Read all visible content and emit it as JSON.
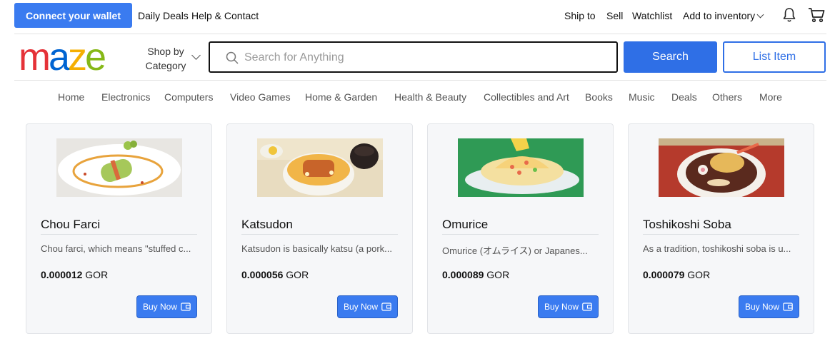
{
  "topbar": {
    "wallet_button": "Connect your wallet",
    "links": [
      "Daily Deals",
      "Help & Contact"
    ],
    "right_links": [
      "Ship to",
      "Sell",
      "Watchlist"
    ],
    "inventory_dropdown": "Add to inventory",
    "icons": [
      "bell-icon",
      "cart-icon"
    ]
  },
  "header": {
    "logo": {
      "text": "maze",
      "colors": [
        "#e53238",
        "#0064d2",
        "#f5af02",
        "#86b817"
      ]
    },
    "shop_by_line1": "Shop by",
    "shop_by_line2": "Category",
    "search_placeholder": "Search for Anything",
    "search_button": "Search",
    "list_button": "List Item"
  },
  "nav": {
    "items": [
      "Home",
      "Electronics",
      "Computers",
      "Video Games",
      "Home & Garden",
      "Health & Beauty",
      "Collectibles and Art",
      "Books",
      "Music",
      "Deals",
      "Others",
      "More"
    ]
  },
  "products": [
    {
      "title": "Chou Farci",
      "description": "Chou farci, which means \"stuffed c...",
      "price": "0.000012",
      "currency": "GOR",
      "button": "Buy Now",
      "image_icon": "chou-farci-image"
    },
    {
      "title": "Katsudon",
      "description": "Katsudon is basically katsu (a pork...",
      "price": "0.000056",
      "currency": "GOR",
      "button": "Buy Now",
      "image_icon": "katsudon-image"
    },
    {
      "title": "Omurice",
      "description": "Omurice (オムライス) or Japanes...",
      "price": "0.000089",
      "currency": "GOR",
      "button": "Buy Now",
      "image_icon": "omurice-image"
    },
    {
      "title": "Toshikoshi Soba",
      "description": "As a tradition, toshikoshi soba is u...",
      "price": "0.000079",
      "currency": "GOR",
      "button": "Buy Now",
      "image_icon": "toshikoshi-soba-image"
    }
  ],
  "colors": {
    "accent": "#2f6fe6",
    "card_bg": "#f6f7f9"
  }
}
